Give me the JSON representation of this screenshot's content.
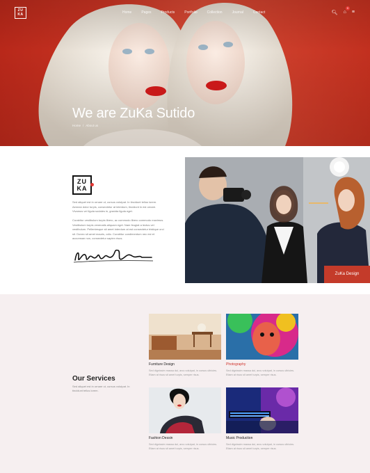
{
  "brand": {
    "logo_line1": "ZU",
    "logo_line2": "KA"
  },
  "nav": {
    "items": [
      "Home",
      "Pages",
      "Products",
      "Portfolio",
      "Collection",
      "Journal",
      "Contact"
    ],
    "cart_count": "0"
  },
  "hero": {
    "title": "We are ZuKa Sutido",
    "breadcrumb_home": "Home",
    "breadcrumb_sep": "/",
    "breadcrumb_current": "About us"
  },
  "about": {
    "logo_line1": "ZU",
    "logo_line2": "KA",
    "paragraph1": "Sed aliquet est in ornare ut, cursus volutpat. In tincidunt tellus lorem. Aenean dolor turpis, consectetur at interdum, tincidunt in est ornare. Vivamus vel ligula sodales in, gravida ligula eget.",
    "paragraph2": "Curabitur vestibulum turpis libero, ac commodo libero commodo maximus. Vestibulum turpis venenatis aliquam eget. Nam feugiat a lectus vel vestibulum. Pellentesque sit amet interdum at est consectetur tristique orci sit. Donec sit amet mauris, odio. Curabitur condimentum nec est et accumsan non, consectetur sapien risus."
  },
  "photo": {
    "tag": "ZuKa Design"
  },
  "services": {
    "title": "Our Services",
    "description": "Sed aliquet est in ornare ut, cursus volutpat. In tincidunt tellus lorem.",
    "cards": [
      {
        "name": "Furniture Design",
        "text": "Sed dignissim massa dui, arcu volutpat, in cursus ultricies. Etiam at risus sit amet turpis, semper risus."
      },
      {
        "name": "Photography",
        "text": "Sed dignissim massa dui, arcu volutpat, in cursus ultricies. Etiam at risus sit amet turpis, semper risus."
      },
      {
        "name": "Fashion Dessin",
        "text": "Sed dignissim massa dui, arcu volutpat, in cursus ultricies. Etiam at risus sit amet turpis, semper risus."
      },
      {
        "name": "Music Production",
        "text": "Sed dignissim massa dui, arcu volutpat, in cursus ultricies. Etiam at risus sit amet turpis, semper risus."
      }
    ]
  },
  "colors": {
    "accent": "#d0332b",
    "hero_red": "#c93423",
    "services_bg": "#f6eff0"
  },
  "icons": [
    "search-icon",
    "cart-icon",
    "menu-icon"
  ]
}
